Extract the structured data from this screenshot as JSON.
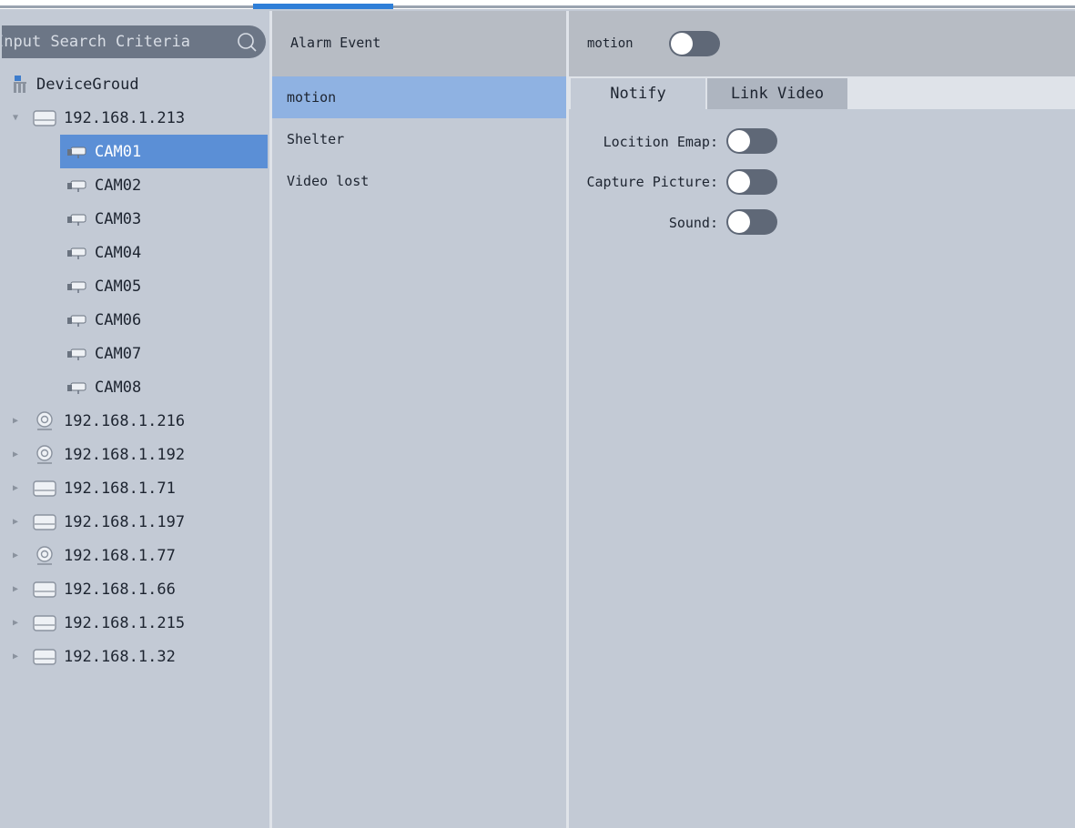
{
  "search": {
    "placeholder": "Input Search Criteria"
  },
  "tree": {
    "root_label": "DeviceGroud",
    "expanded_device": "192.168.1.213",
    "cameras": [
      "CAM01",
      "CAM02",
      "CAM03",
      "CAM04",
      "CAM05",
      "CAM06",
      "CAM07",
      "CAM08"
    ],
    "selected_camera": "CAM01",
    "other_devices": [
      {
        "label": "192.168.1.216",
        "icon": "webcam-icon"
      },
      {
        "label": "192.168.1.192",
        "icon": "webcam-icon"
      },
      {
        "label": "192.168.1.71",
        "icon": "nvr-icon"
      },
      {
        "label": "192.168.1.197",
        "icon": "nvr-icon"
      },
      {
        "label": "192.168.1.77",
        "icon": "webcam-icon"
      },
      {
        "label": "192.168.1.66",
        "icon": "nvr-icon"
      },
      {
        "label": "192.168.1.215",
        "icon": "nvr-icon"
      },
      {
        "label": "192.168.1.32",
        "icon": "nvr-icon"
      }
    ]
  },
  "events": {
    "header": "Alarm Event",
    "items": [
      "motion",
      "Shelter",
      "Video lost"
    ],
    "selected": "motion"
  },
  "detail": {
    "title": "motion",
    "enabled": false,
    "tabs": [
      "Notify",
      "Link Video"
    ],
    "active_tab": "Notify",
    "options": [
      {
        "label": "Locition Emap:",
        "on": false
      },
      {
        "label": "Capture Picture:",
        "on": false
      },
      {
        "label": "Sound:",
        "on": false
      }
    ]
  },
  "colors": {
    "accent": "#2f7fd8",
    "selection": "#5b8fd6",
    "panel": "#c3cad5"
  }
}
